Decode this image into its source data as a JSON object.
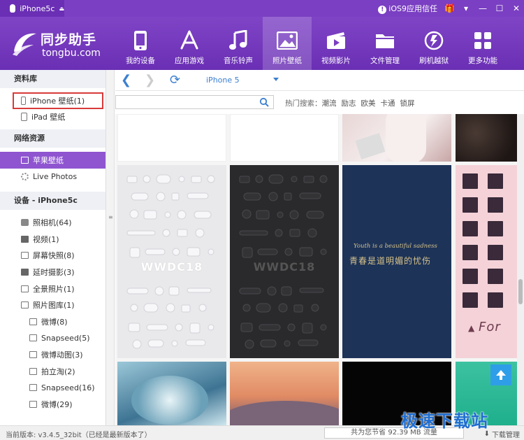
{
  "titlebar": {
    "device": "iPhone5c",
    "trust_label": "iOS9应用信任"
  },
  "logo": {
    "cn": "同步助手",
    "en": "tongbu.com"
  },
  "nav": [
    {
      "label": "我的设备",
      "icon": "phone-icon"
    },
    {
      "label": "应用游戏",
      "icon": "appstore-icon"
    },
    {
      "label": "音乐铃声",
      "icon": "music-note-icon"
    },
    {
      "label": "照片壁纸",
      "icon": "picture-icon"
    },
    {
      "label": "视频影片",
      "icon": "film-icon"
    },
    {
      "label": "文件管理",
      "icon": "folder-icon"
    },
    {
      "label": "刷机越狱",
      "icon": "flash-icon"
    },
    {
      "label": "更多功能",
      "icon": "grid-icon"
    }
  ],
  "sidebar": {
    "library_header": "资料库",
    "library_items": [
      "iPhone 壁纸(1)",
      "iPad 壁纸"
    ],
    "network_header": "网络资源",
    "network_items": [
      "苹果壁纸",
      "Live Photos"
    ],
    "device_header": "设备 - iPhone5c",
    "device_items": [
      "照相机(64)",
      "视频(1)",
      "屏幕快照(8)",
      "延时摄影(3)",
      "全景照片(1)",
      "照片图库(1)"
    ],
    "album_items": [
      "微博(8)",
      "Snapseed(5)",
      "微博动图(3)",
      "拍立淘(2)",
      "Snapseed(16)",
      "微博(29)"
    ]
  },
  "topbar": {
    "device_select": "iPhone 5"
  },
  "search": {
    "placeholder": "",
    "hot_label": "热门搜索：",
    "keywords": [
      "潮流",
      "励志",
      "欧美",
      "卡通",
      "锁屏"
    ]
  },
  "wallpapers": {
    "wwdc_text": "WWDC18",
    "navy_line1": "Youth is a beautiful sadness",
    "navy_line2": "青春是道明媚的忧伤",
    "for_text": "For"
  },
  "statusbar": {
    "version": "当前版本: v3.4.5_32bit（已经是最新版本了）",
    "saved": "共为您节省  92.39 MB 流量",
    "download": "下载管理"
  },
  "watermark": "极速下载站",
  "colors": {
    "brand": "#7a3fc2",
    "active_item": "#8f55d0",
    "link": "#3b7fd0",
    "highlight_box": "#d93a3a"
  }
}
